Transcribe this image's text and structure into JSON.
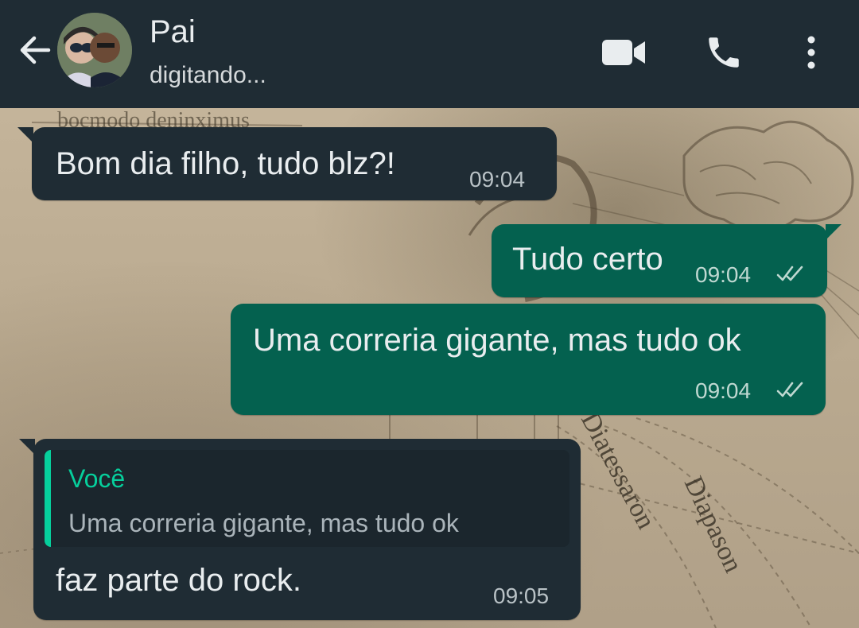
{
  "header": {
    "contact_name": "Pai",
    "status": "digitando...",
    "icons": [
      "back-arrow-icon",
      "avatar",
      "video-call-icon",
      "voice-call-icon",
      "more-options-icon"
    ]
  },
  "colors": {
    "header_bg": "#1f2c34",
    "incoming_bubble": "#1f2c34",
    "outgoing_bubble": "#04614f",
    "quote_accent": "#06cf9c",
    "read_ticks": "#bfd8d1"
  },
  "wallpaper": {
    "labels": [
      "bocmodo deninximus",
      "Diatessaron",
      "Diapason"
    ]
  },
  "messages": [
    {
      "direction": "incoming",
      "text": "Bom dia filho, tudo blz?!",
      "time": "09:04"
    },
    {
      "direction": "outgoing",
      "text": "Tudo certo",
      "time": "09:04",
      "status": "read"
    },
    {
      "direction": "outgoing",
      "text": "Uma correria gigante, mas tudo ok",
      "time": "09:04",
      "status": "read"
    },
    {
      "direction": "incoming",
      "quote": {
        "author": "Você",
        "text": "Uma correria gigante, mas tudo ok"
      },
      "text": "faz parte do rock.",
      "time": "09:05"
    }
  ]
}
